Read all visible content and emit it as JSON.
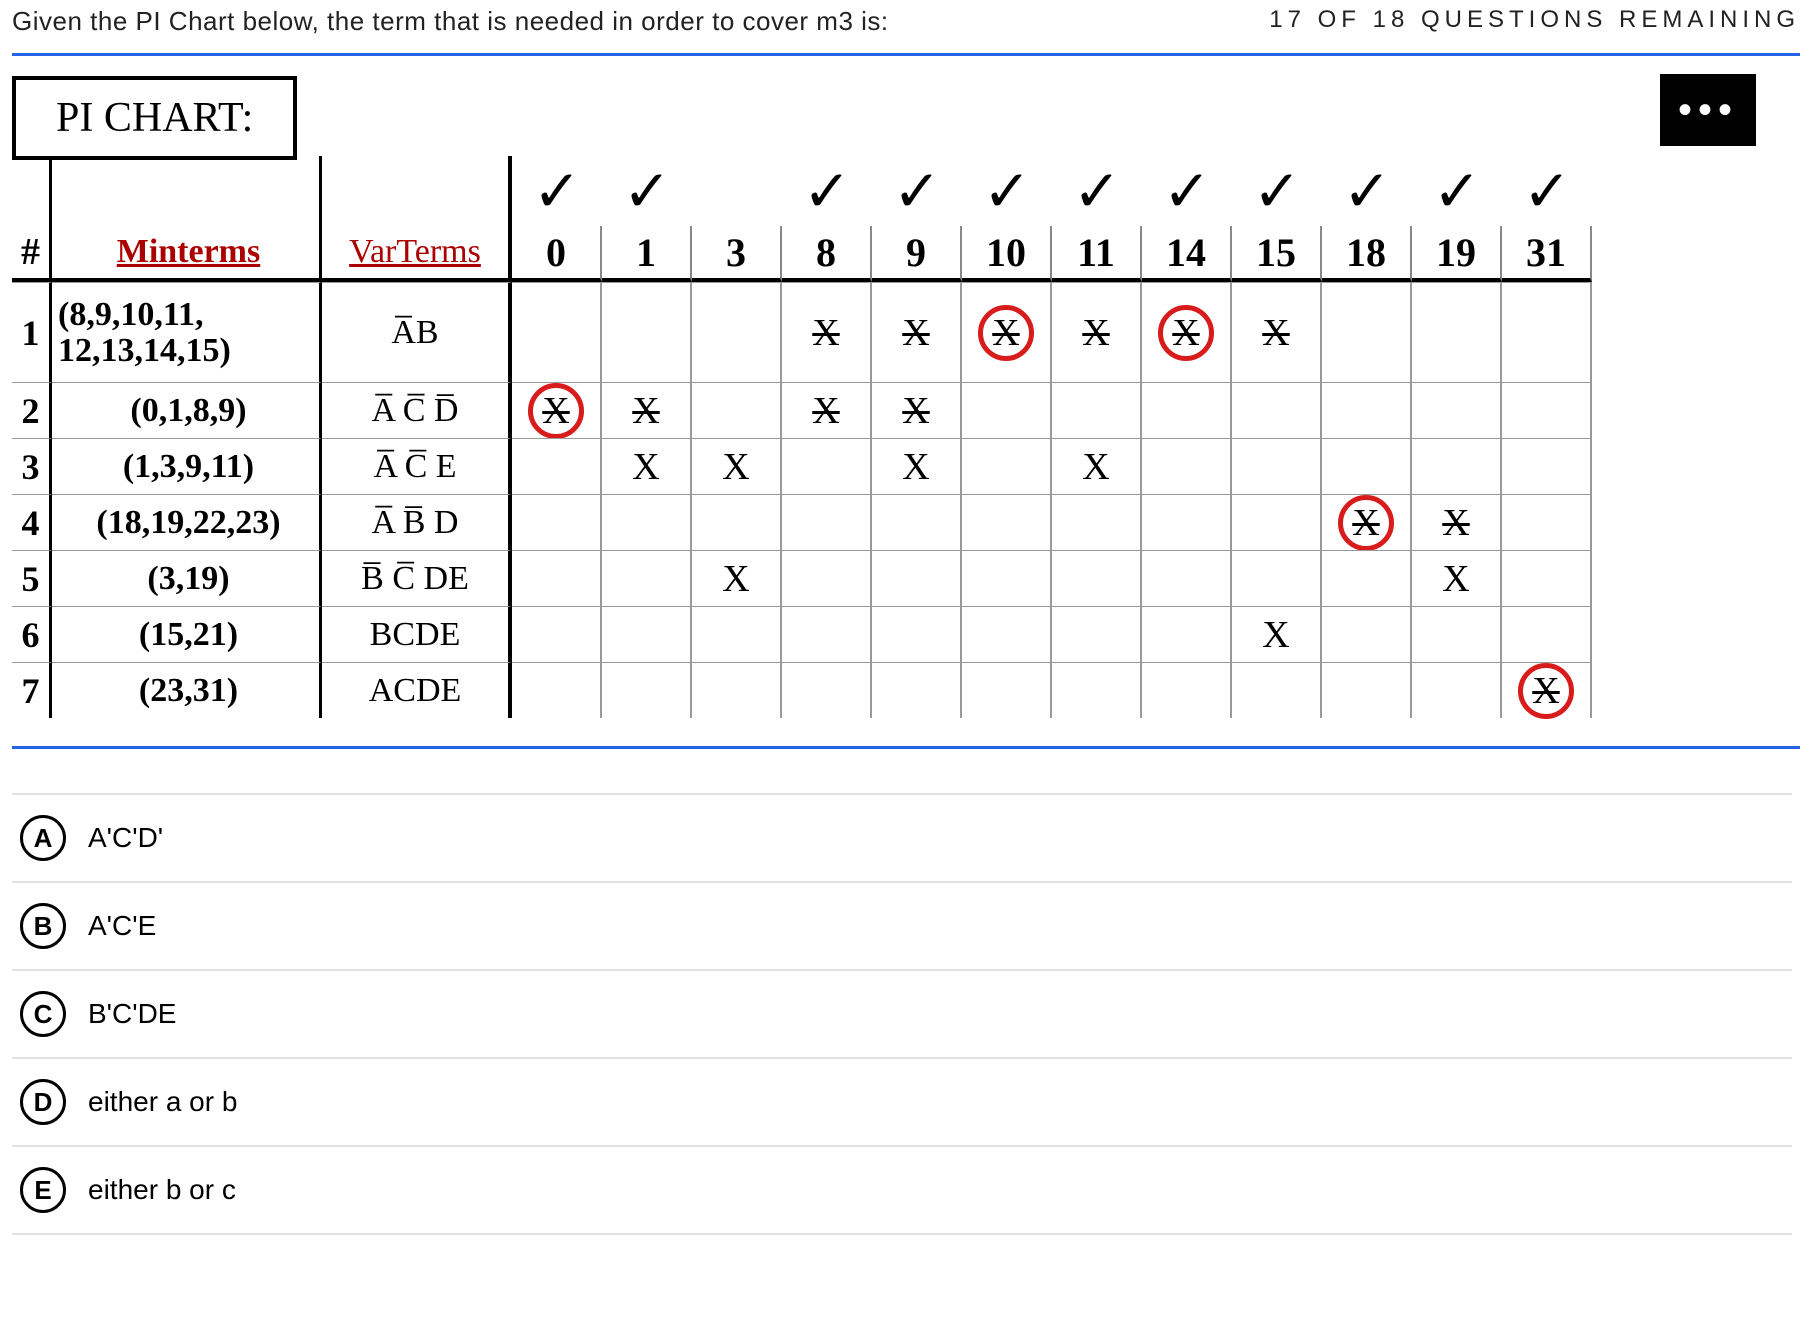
{
  "question_counter": "17 OF 18 QUESTIONS REMAINING",
  "question_text": "Given the PI Chart below, the term that is needed in order to cover m3 is:",
  "pi_title": "PI CHART:",
  "more_button": "•••",
  "table": {
    "hash": "#",
    "col_minterms_label": "Minterms",
    "col_varterms_label": "VarTerms",
    "checks": [
      "✓",
      "✓",
      "",
      "✓",
      "✓",
      "✓",
      "✓",
      "✓",
      "✓",
      "✓",
      "✓",
      "✓"
    ],
    "cols": [
      "0",
      "1",
      "3",
      "8",
      "9",
      "10",
      "11",
      "14",
      "15",
      "18",
      "19",
      "31"
    ],
    "rows": [
      {
        "n": "1",
        "minterms_l1": "(8,9,10,11,",
        "minterms_l2": "12,13,14,15)",
        "var": "A̅B",
        "cells": [
          "",
          "",
          "",
          "X",
          "X",
          "X",
          "X",
          "X",
          "X",
          "",
          "",
          ""
        ],
        "struck": [
          false,
          false,
          false,
          true,
          true,
          true,
          true,
          true,
          true,
          false,
          false,
          false
        ],
        "circled": [
          false,
          false,
          false,
          false,
          false,
          true,
          false,
          true,
          false,
          false,
          false,
          false
        ],
        "lineThrough": true
      },
      {
        "n": "2",
        "minterms": "(0,1,8,9)",
        "var": "A̅ C̅ D̅",
        "cells": [
          "X",
          "X",
          "",
          "X",
          "X",
          "",
          "",
          "",
          "",
          "",
          "",
          ""
        ],
        "struck": [
          true,
          true,
          false,
          true,
          true,
          false,
          false,
          false,
          false,
          false,
          false,
          false
        ],
        "circled": [
          true,
          false,
          false,
          false,
          false,
          false,
          false,
          false,
          false,
          false,
          false,
          false
        ],
        "lineThrough": true
      },
      {
        "n": "3",
        "minterms": "(1,3,9,11)",
        "var": "A̅ C̅ E",
        "cells": [
          "",
          "X",
          "X",
          "",
          "X",
          "",
          "X",
          "",
          "",
          "",
          "",
          ""
        ],
        "struck": [
          false,
          false,
          false,
          false,
          false,
          false,
          false,
          false,
          false,
          false,
          false,
          false
        ],
        "circled": [
          false,
          false,
          false,
          false,
          false,
          false,
          false,
          false,
          false,
          false,
          false,
          false
        ],
        "lineThrough": false
      },
      {
        "n": "4",
        "minterms": "(18,19,22,23)",
        "var": "A̅ B̅ D",
        "cells": [
          "",
          "",
          "",
          "",
          "",
          "",
          "",
          "",
          "",
          "X",
          "X",
          ""
        ],
        "struck": [
          false,
          false,
          false,
          false,
          false,
          false,
          false,
          false,
          false,
          true,
          true,
          false
        ],
        "circled": [
          false,
          false,
          false,
          false,
          false,
          false,
          false,
          false,
          false,
          true,
          false,
          false
        ],
        "lineThrough": true
      },
      {
        "n": "5",
        "minterms": "(3,19)",
        "var": "B̅ C̅ DE",
        "cells": [
          "",
          "",
          "X",
          "",
          "",
          "",
          "",
          "",
          "",
          "",
          "X",
          ""
        ],
        "struck": [
          false,
          false,
          false,
          false,
          false,
          false,
          false,
          false,
          false,
          false,
          false,
          false
        ],
        "circled": [
          false,
          false,
          false,
          false,
          false,
          false,
          false,
          false,
          false,
          false,
          false,
          false
        ],
        "lineThrough": false
      },
      {
        "n": "6",
        "minterms": "(15,21)",
        "var": "BCDE",
        "cells": [
          "",
          "",
          "",
          "",
          "",
          "",
          "",
          "",
          "X",
          "",
          "",
          ""
        ],
        "struck": [
          false,
          false,
          false,
          false,
          false,
          false,
          false,
          false,
          false,
          false,
          false,
          false
        ],
        "circled": [
          false,
          false,
          false,
          false,
          false,
          false,
          false,
          false,
          false,
          false,
          false,
          false
        ],
        "lineThrough": false
      },
      {
        "n": "7",
        "minterms": "(23,31)",
        "var": "ACDE",
        "cells": [
          "",
          "",
          "",
          "",
          "",
          "",
          "",
          "",
          "",
          "",
          "",
          "X"
        ],
        "struck": [
          false,
          false,
          false,
          false,
          false,
          false,
          false,
          false,
          false,
          false,
          false,
          true
        ],
        "circled": [
          false,
          false,
          false,
          false,
          false,
          false,
          false,
          false,
          false,
          false,
          false,
          true
        ],
        "lineThrough": false
      }
    ]
  },
  "choices": [
    {
      "letter": "A",
      "text": "A'C'D'"
    },
    {
      "letter": "B",
      "text": "A'C'E"
    },
    {
      "letter": "C",
      "text": "B'C'DE"
    },
    {
      "letter": "D",
      "text": "either a or b"
    },
    {
      "letter": "E",
      "text": "either b or c"
    }
  ]
}
